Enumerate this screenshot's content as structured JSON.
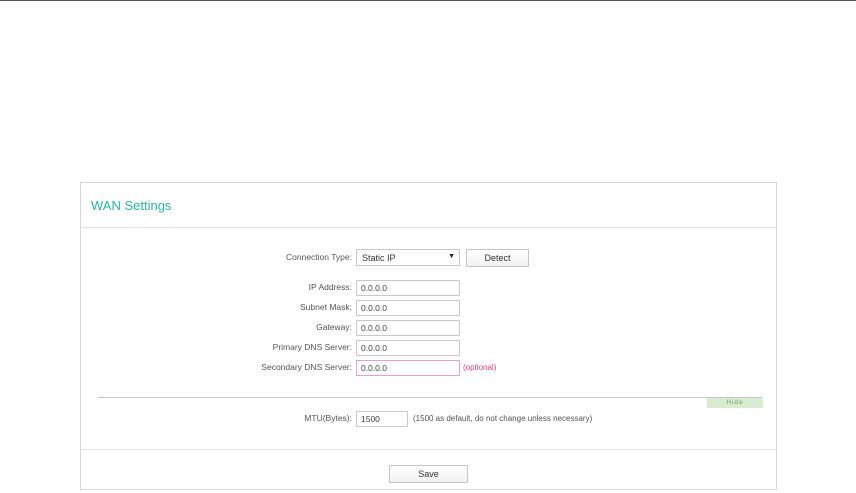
{
  "panel": {
    "title": "WAN Settings"
  },
  "form": {
    "connection_type": {
      "label": "Connection Type:",
      "value": "Static IP",
      "arrow": "▼"
    },
    "detect_label": "Detect",
    "fields": [
      {
        "label": "IP Address:",
        "value": "0.0.0.0"
      },
      {
        "label": "Subnet Mask:",
        "value": "0.0.0.0"
      },
      {
        "label": "Gateway:",
        "value": "0.0.0.0"
      },
      {
        "label": "Primary DNS Server:",
        "value": "0.0.0.0"
      },
      {
        "label": "Secondary DNS Server:",
        "value": "0.0.0.0",
        "note": "(optional)"
      }
    ],
    "hide_label": "Hide",
    "mtu": {
      "label": "MTU(Bytes):",
      "value": "1500",
      "hint": "(1500 as default, do not change unless necessary)"
    },
    "save_label": "Save"
  },
  "colors": {
    "title": "#2bb3a3",
    "optional": "#e0457b",
    "hide_bg": "#d9ecd2"
  }
}
